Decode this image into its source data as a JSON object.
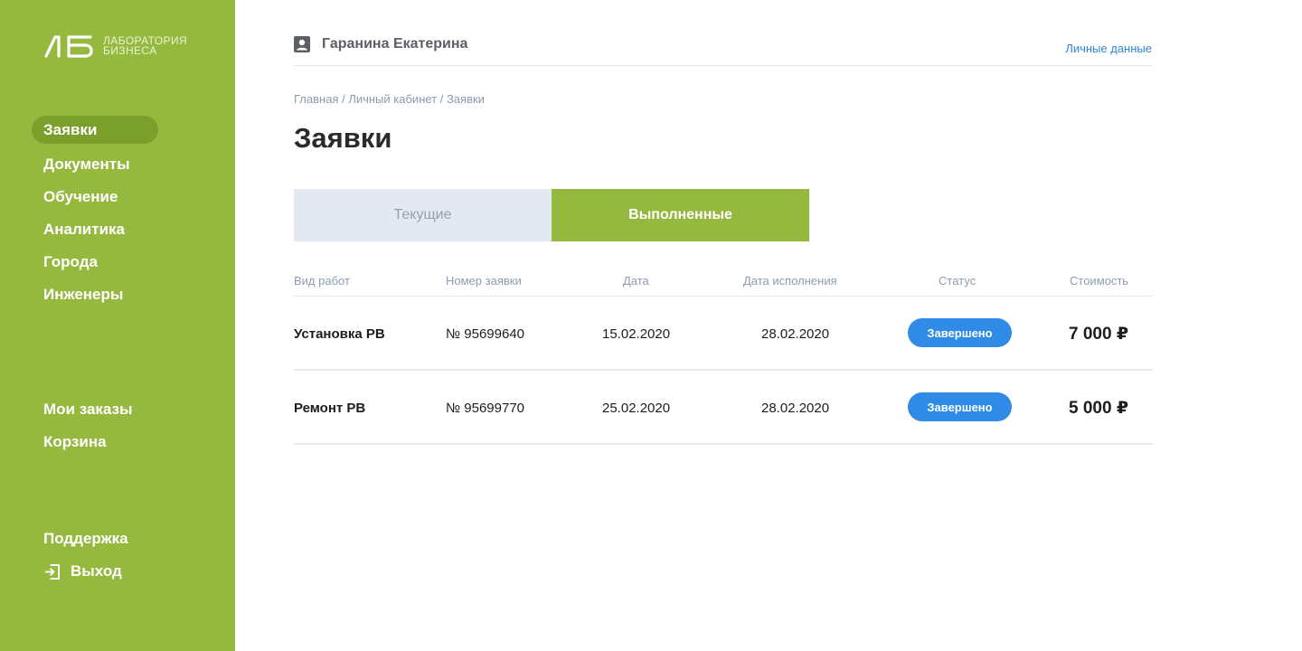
{
  "brand": {
    "line1": "ЛАБОРАТОРИЯ",
    "line2": "БИЗНЕСА",
    "mark_color": "#ffffff"
  },
  "sidebar": {
    "main": [
      {
        "label": "Заявки",
        "active": true
      },
      {
        "label": "Документы"
      },
      {
        "label": "Обучение"
      },
      {
        "label": "Аналитика"
      },
      {
        "label": "Города"
      },
      {
        "label": "Инженеры"
      }
    ],
    "orders": [
      {
        "label": "Мои заказы"
      },
      {
        "label": "Корзина"
      }
    ],
    "bottom": [
      {
        "label": "Поддержка"
      },
      {
        "label": "Выход",
        "icon": "exit-icon"
      }
    ]
  },
  "header": {
    "user_name": "Гаранина Екатерина",
    "user_icon": "user-profile-icon",
    "personal_link": "Личные данные"
  },
  "breadcrumb": "Главная / Личный кабинет / Заявки",
  "page_title": "Заявки",
  "tabs": [
    {
      "label": "Текущие",
      "active": false
    },
    {
      "label": "Выполненные",
      "active": true
    }
  ],
  "table": {
    "columns": [
      "Вид работ",
      "Номер заявки",
      "Дата",
      "Дата исполнения",
      "Статус",
      "Стоимость"
    ],
    "rows": [
      {
        "type": "Установка РВ",
        "number": "№ 95699640",
        "date": "15.02.2020",
        "done_date": "28.02.2020",
        "status": "Завершено",
        "price": "7 000 ₽"
      },
      {
        "type": "Ремонт РВ",
        "number": "№ 95699770",
        "date": "25.02.2020",
        "done_date": "28.02.2020",
        "status": "Завершено",
        "price": "5 000 ₽"
      }
    ]
  },
  "colors": {
    "accent_green": "#95b93e",
    "active_green": "#7aa02b",
    "status_blue": "#2f8be6",
    "link_blue": "#2f86d6"
  }
}
